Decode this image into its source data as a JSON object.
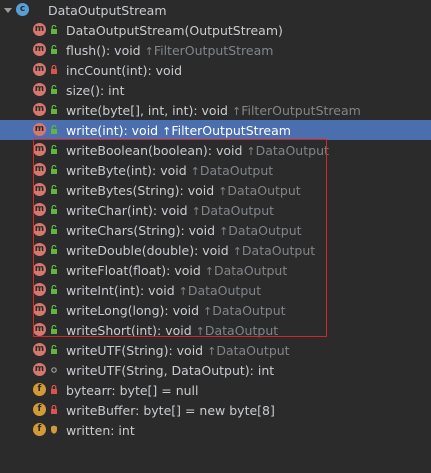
{
  "root": {
    "label": "DataOutputStream",
    "icon": "class-icon"
  },
  "members": [
    {
      "label": "DataOutputStream(OutputStream)",
      "origin": "",
      "kind": "method",
      "visibility": "public",
      "selected": false
    },
    {
      "label": "flush(): void",
      "origin": "FilterOutputStream",
      "kind": "method",
      "visibility": "public",
      "selected": false
    },
    {
      "label": "incCount(int): void",
      "origin": "",
      "kind": "method",
      "visibility": "private",
      "selected": false
    },
    {
      "label": "size(): int",
      "origin": "",
      "kind": "method",
      "visibility": "public",
      "selected": false
    },
    {
      "label": "write(byte[], int, int): void",
      "origin": "FilterOutputStream",
      "kind": "method",
      "visibility": "public",
      "selected": false
    },
    {
      "label": "write(int): void",
      "origin": "FilterOutputStream",
      "kind": "method",
      "visibility": "public",
      "selected": true
    },
    {
      "label": "writeBoolean(boolean): void",
      "origin": "DataOutput",
      "kind": "method",
      "visibility": "public",
      "selected": false
    },
    {
      "label": "writeByte(int): void",
      "origin": "DataOutput",
      "kind": "method",
      "visibility": "public",
      "selected": false
    },
    {
      "label": "writeBytes(String): void",
      "origin": "DataOutput",
      "kind": "method",
      "visibility": "public",
      "selected": false
    },
    {
      "label": "writeChar(int): void",
      "origin": "DataOutput",
      "kind": "method",
      "visibility": "public",
      "selected": false
    },
    {
      "label": "writeChars(String): void",
      "origin": "DataOutput",
      "kind": "method",
      "visibility": "public",
      "selected": false
    },
    {
      "label": "writeDouble(double): void",
      "origin": "DataOutput",
      "kind": "method",
      "visibility": "public",
      "selected": false
    },
    {
      "label": "writeFloat(float): void",
      "origin": "DataOutput",
      "kind": "method",
      "visibility": "public",
      "selected": false
    },
    {
      "label": "writeInt(int): void",
      "origin": "DataOutput",
      "kind": "method",
      "visibility": "public",
      "selected": false
    },
    {
      "label": "writeLong(long): void",
      "origin": "DataOutput",
      "kind": "method",
      "visibility": "public",
      "selected": false
    },
    {
      "label": "writeShort(int): void",
      "origin": "DataOutput",
      "kind": "method",
      "visibility": "public",
      "selected": false
    },
    {
      "label": "writeUTF(String): void",
      "origin": "DataOutput",
      "kind": "method",
      "visibility": "public",
      "selected": false
    },
    {
      "label": "writeUTF(String, DataOutput): int",
      "origin": "",
      "kind": "method",
      "visibility": "package",
      "selected": false
    },
    {
      "label": "bytearr: byte[] = null",
      "origin": "",
      "kind": "field",
      "visibility": "private",
      "selected": false
    },
    {
      "label": "writeBuffer: byte[] = new byte[8]",
      "origin": "",
      "kind": "field",
      "visibility": "private",
      "selected": false
    },
    {
      "label": "written: int",
      "origin": "",
      "kind": "field",
      "visibility": "protected",
      "selected": false
    }
  ],
  "origin_arrow": "↑",
  "colors": {
    "background": "#2b2b2b",
    "selection": "#4b6eaf",
    "highlight_box": "#d4252b",
    "method_icon": "#d7776d",
    "field_icon": "#d49a36",
    "public": "#62b543",
    "private": "#d9534f",
    "protected": "#d49a36"
  }
}
